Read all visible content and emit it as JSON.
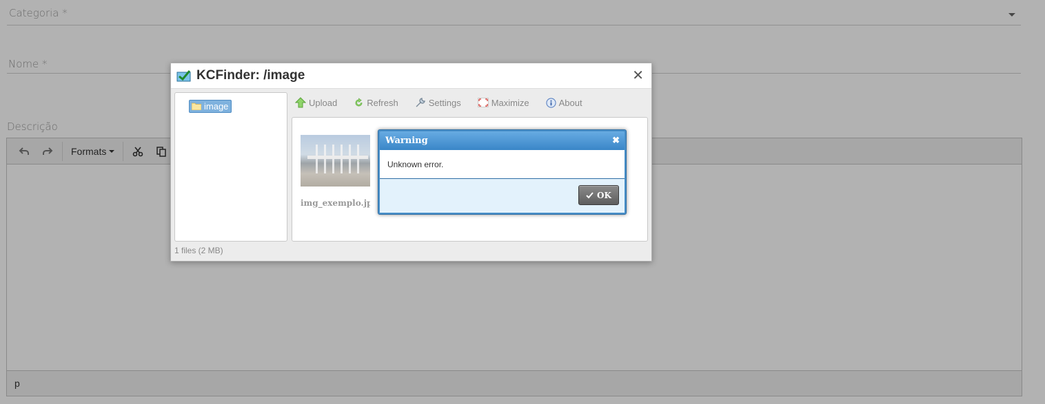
{
  "form": {
    "categoria_label": "Categoria *",
    "nome_label": "Nome *",
    "descricao_label": "Descrição"
  },
  "editor": {
    "toolbar": {
      "formats_label": "Formats"
    },
    "statusbar_path": "p"
  },
  "kcfinder": {
    "title": "KCFinder: /image",
    "folder": "image",
    "toolbar": {
      "upload": "Upload",
      "refresh": "Refresh",
      "settings": "Settings",
      "maximize": "Maximize",
      "about": "About"
    },
    "file_name": "img_exemplo.jpg",
    "status": "1 files (2 MB)"
  },
  "warning": {
    "title": "Warning",
    "message": "Unknown error.",
    "ok_label": "OK"
  },
  "colors": {
    "overlay": "rgba(0,0,0,0.3)",
    "folder_selected": "#7fb2de",
    "warning_title": "#3a86c8",
    "warning_footer": "#e3f2fc",
    "ok_button": "#5e5e5e"
  },
  "icons": {
    "kcfinder_logo": "checkmark-icon",
    "dialog_close": "close-icon",
    "undo": "undo-icon",
    "redo": "redo-icon",
    "cut": "scissors-icon",
    "copy": "copy-icon"
  }
}
